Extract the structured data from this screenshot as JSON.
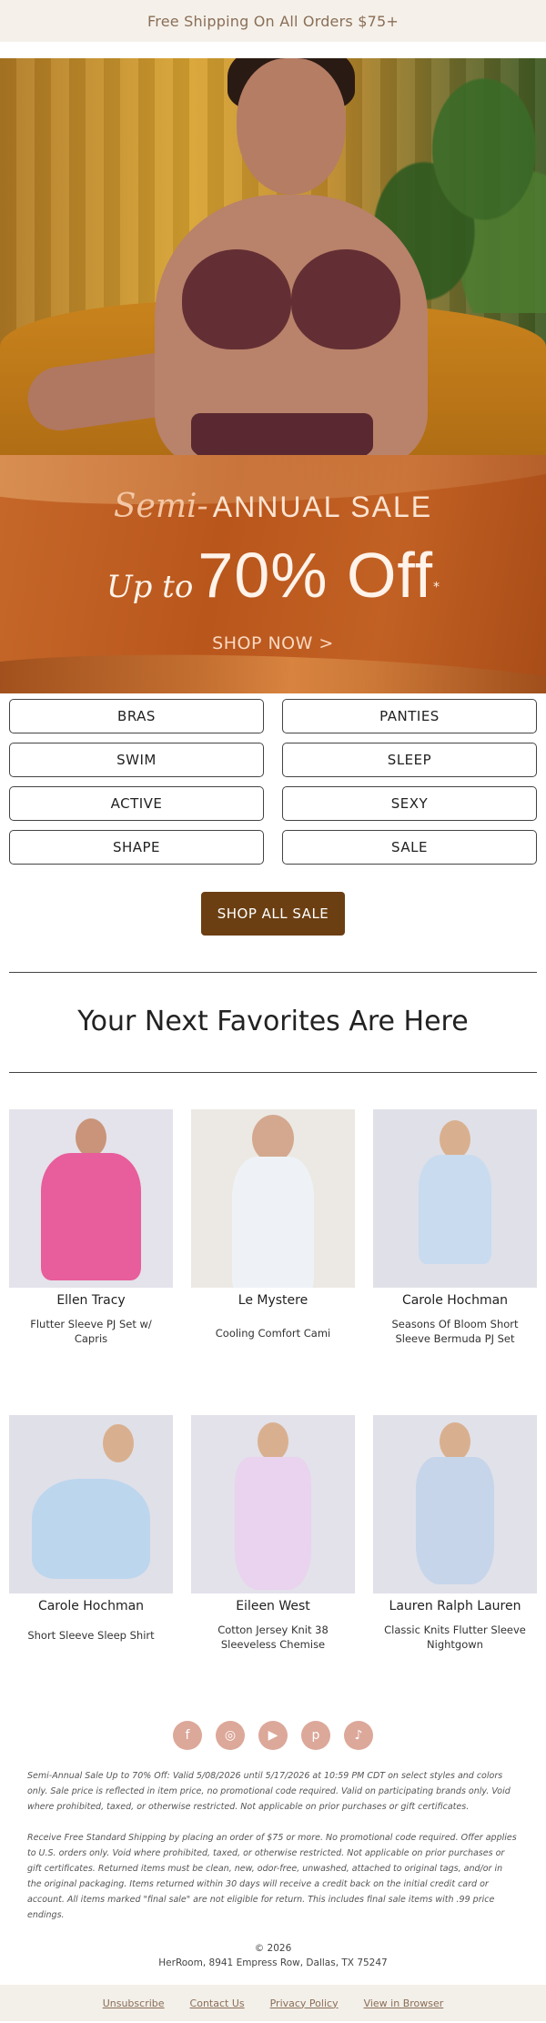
{
  "topbar": {
    "text": "Free Shipping On All Orders $75+"
  },
  "sale_banner": {
    "semi": "Semi",
    "dash": "-",
    "annual": "ANNUAL SALE",
    "upto": "Up to",
    "percent": "70% Off",
    "asterisk": "*",
    "cta": "SHOP NOW >"
  },
  "categories": [
    "BRAS",
    "PANTIES",
    "SWIM",
    "SLEEP",
    "ACTIVE",
    "SEXY",
    "SHAPE",
    "SALE"
  ],
  "shop_all": "SHOP ALL SALE",
  "favorites_title": "Your Next Favorites Are Here",
  "products": [
    {
      "brand": "Ellen Tracy",
      "name": "Flutter Sleeve PJ Set w/ Capris",
      "color": "#e85d9c",
      "bg": "#e4e2ea"
    },
    {
      "brand": "Le Mystere",
      "name": "Cooling Comfort Cami",
      "color": "#e9eef3",
      "bg": "#ece9e4"
    },
    {
      "brand": "Carole Hochman",
      "name": "Seasons Of Bloom Short Sleeve Bermuda PJ Set",
      "color": "#c9dbef",
      "bg": "#e0e0e8"
    },
    {
      "brand": "Carole Hochman",
      "name": "Short Sleeve Sleep Shirt",
      "color": "#bcd6ee",
      "bg": "#e0e0e8"
    },
    {
      "brand": "Eileen West",
      "name": "Cotton Jersey Knit 38 Sleeveless Chemise",
      "color": "#e9d3ee",
      "bg": "#e3e1ea"
    },
    {
      "brand": "Lauren Ralph Lauren",
      "name": "Classic Knits Flutter Sleeve Nightgown",
      "color": "#c6d5ea",
      "bg": "#e1e1e9"
    }
  ],
  "social": [
    {
      "name": "facebook-icon",
      "glyph": "f"
    },
    {
      "name": "instagram-icon",
      "glyph": "◎"
    },
    {
      "name": "youtube-icon",
      "glyph": "▶"
    },
    {
      "name": "pinterest-icon",
      "glyph": "p"
    },
    {
      "name": "tiktok-icon",
      "glyph": "♪"
    }
  ],
  "fine_print": {
    "p1": "Semi-Annual Sale Up to 70% Off: Valid 5/08/2026 until 5/17/2026 at 10:59 PM CDT on select styles and colors only. Sale price is reflected in item price, no promotional code required. Valid on participating brands only. Void where prohibited, taxed, or otherwise restricted. Not applicable on prior purchases or gift certificates.",
    "p2": "Receive Free Standard Shipping by placing an order of $75 or more. No promotional code required. Offer applies to U.S. orders only. Void where prohibited, taxed, or otherwise restricted. Not applicable on prior purchases or gift certificates. Returned items must be clean, new, odor-free, unwashed, attached to original tags, and/or in the original packaging. Items returned within 30 days will receive a credit back on the initial credit card or account. All items marked \"final sale\" are not eligible for return. This includes final sale items with .99 price endings."
  },
  "copyright": "© 2026",
  "address": "HerRoom, 8941 Empress Row, Dallas, TX 75247",
  "footer_links": [
    "Unsubscribe",
    "Contact Us",
    "Privacy Policy",
    "View in Browser"
  ]
}
